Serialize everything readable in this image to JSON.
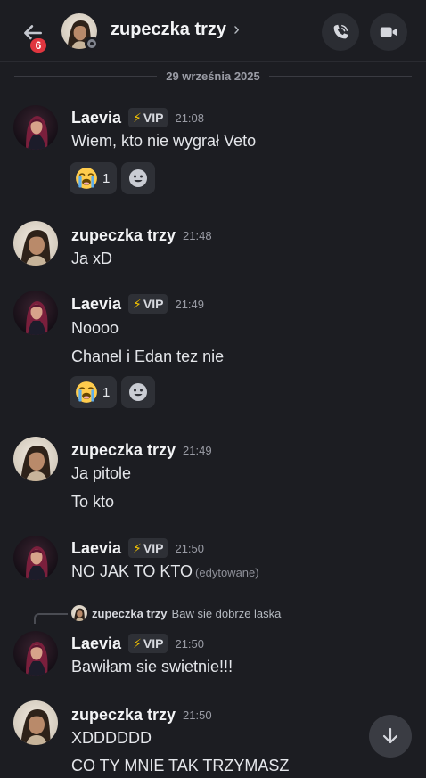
{
  "header": {
    "unread_badge": "6",
    "title": "zupeczka trzy",
    "title_chevron": "›"
  },
  "date_divider": "29 września 2025",
  "messages": [
    {
      "author": "Laevia",
      "role_icon": "⚡",
      "role": "VIP",
      "time": "21:08",
      "lines": [
        "Wiem, kto nie wygrał Veto"
      ],
      "reaction_count": "1"
    },
    {
      "author": "zupeczka trzy",
      "time": "21:48",
      "lines": [
        "Ja xD"
      ]
    },
    {
      "author": "Laevia",
      "role_icon": "⚡",
      "role": "VIP",
      "time": "21:49",
      "lines": [
        "Noooo",
        "Chanel i Edan tez nie"
      ],
      "reaction_count": "1"
    },
    {
      "author": "zupeczka trzy",
      "time": "21:49",
      "lines": [
        "Ja pitole",
        "To kto"
      ]
    },
    {
      "author": "Laevia",
      "role_icon": "⚡",
      "role": "VIP",
      "time": "21:50",
      "lines": [
        "NO JAK TO KTO"
      ],
      "edited": "(edytowane)"
    },
    {
      "reply_to": {
        "author": "zupeczka trzy",
        "text": "Baw sie dobrze laska"
      },
      "author": "Laevia",
      "role_icon": "⚡",
      "role": "VIP",
      "time": "21:50",
      "lines": [
        "Bawiłam sie swietnie!!!"
      ]
    },
    {
      "author": "zupeczka trzy",
      "time": "21:50",
      "lines": [
        "XDDDDDD",
        "CO TY MNIE TAK TRZYMASZ"
      ]
    }
  ],
  "colors": {
    "background": "#1c1d22",
    "badge": "#e0363f",
    "vip_bolt": "#f5c400"
  },
  "icons": {
    "back": "arrow-left-icon",
    "call": "phone-icon",
    "video": "video-camera-icon",
    "reaction_emoji": "loudly-crying-face-emoji",
    "add_reaction": "smiley-add-reaction-icon",
    "scroll": "arrow-down-icon"
  }
}
